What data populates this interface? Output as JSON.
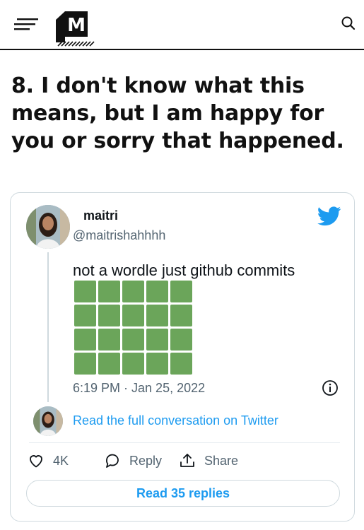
{
  "site": {
    "logo_letter": "M"
  },
  "article": {
    "headline": "8. I don't know what this means, but I am happy for you or sorry that happened."
  },
  "tweet": {
    "author_name": "maitri",
    "author_handle": "@maitrishahhhh",
    "text": "not a wordle just github commits",
    "grid": {
      "rows": 4,
      "cols": 5,
      "cell_color": "#6ba55a"
    },
    "timestamp": "6:19 PM · Jan 25, 2022",
    "read_conversation": "Read the full conversation on Twitter",
    "likes_count": "4K",
    "reply_label": "Reply",
    "share_label": "Share",
    "read_replies": "Read 35 replies"
  },
  "colors": {
    "twitter_blue": "#1d9bf0",
    "muted_text": "#536471",
    "border": "#cfd9de",
    "commit_green": "#6ba55a"
  },
  "icons": [
    "menu-icon",
    "logo-icon",
    "search-icon",
    "twitter-bird-icon",
    "info-icon",
    "heart-icon",
    "reply-bubble-icon",
    "share-icon"
  ]
}
